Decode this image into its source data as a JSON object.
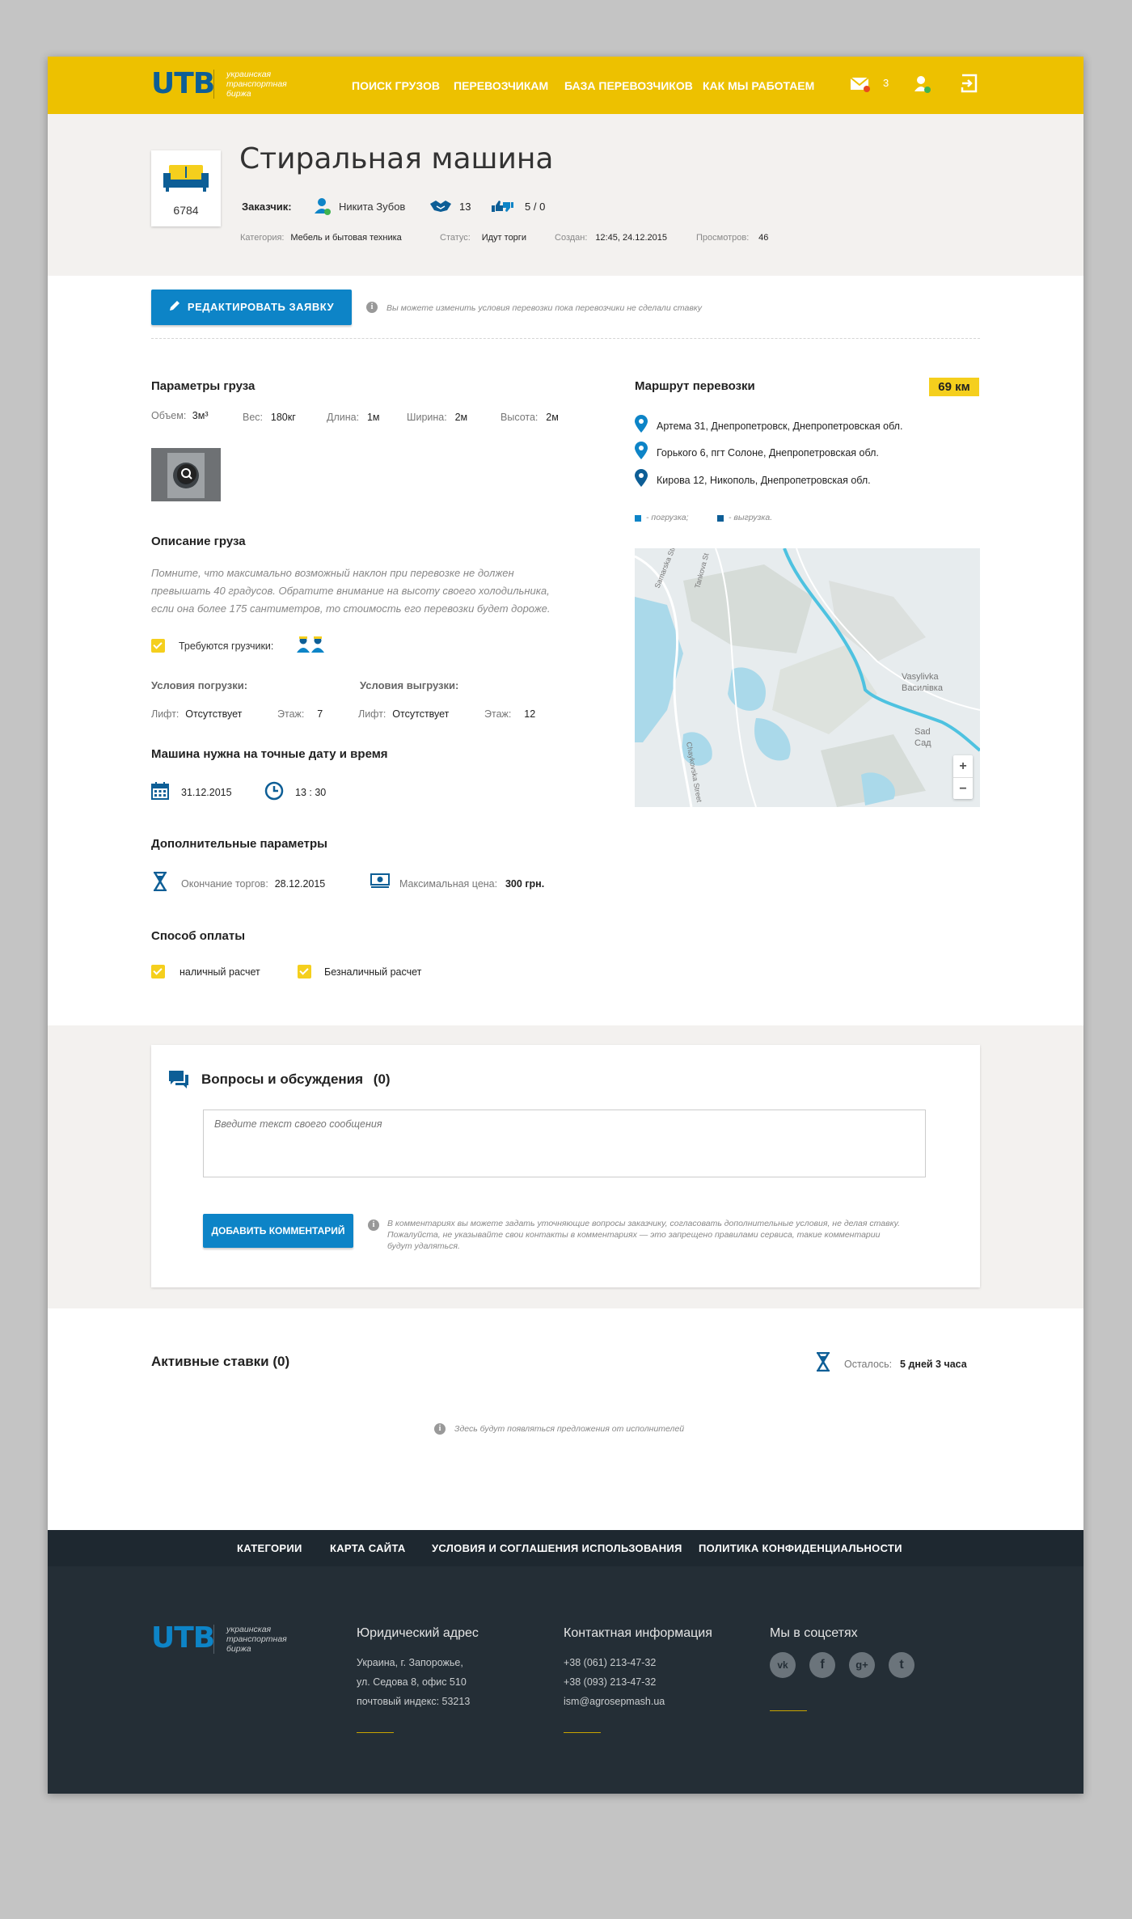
{
  "header": {
    "logo": "UTB",
    "logo_sub": [
      "украинская",
      "транспортная",
      "биржа"
    ],
    "nav": [
      "ПОИСК ГРУЗОВ",
      "ПЕРЕВОЗЧИКАМ",
      "БАЗА ПЕРЕВОЗЧИКОВ",
      "КАК МЫ РАБОТАЕМ"
    ],
    "messages_count": "3"
  },
  "cargo": {
    "id": "6784",
    "title": "Стиральная машина",
    "customer_label": "Заказчик:",
    "customer_name": "Никита Зубов",
    "deals": "13",
    "rating": "5 / 0",
    "meta": [
      {
        "label": "Категория:",
        "value": "Мебель и бытовая техника"
      },
      {
        "label": "Статус:",
        "value": "Идут торги"
      },
      {
        "label": "Создан:",
        "value": "12:45, 24.12.2015"
      },
      {
        "label": "Просмотров:",
        "value": "46"
      }
    ]
  },
  "edit": {
    "button": "РЕДАКТИРОВАТЬ ЗАЯВКУ",
    "note": "Вы можете изменить условия перевозки пока  перевозчики не сделали ставку"
  },
  "params": {
    "title": "Параметры груза",
    "items": [
      {
        "label": "Объем:",
        "value": "3м³"
      },
      {
        "label": "Вес:",
        "value": "180кг"
      },
      {
        "label": "Длина:",
        "value": "1м"
      },
      {
        "label": "Ширина:",
        "value": "2м"
      },
      {
        "label": "Высота:",
        "value": "2м"
      }
    ]
  },
  "description": {
    "title": "Описание груза",
    "lines": [
      "Помните, что максимально возможный наклон при перевозке не должен",
      "превышать 40 градусов. Обратите внимание на высоту своего холодильника,",
      "если она более 175 сантиметров, то стоимость его перевозки будет дороже."
    ],
    "loaders_label": "Требуются грузчики:"
  },
  "conditions": {
    "loading_title": "Условия погрузки:",
    "unloading_title": "Условия выгрузки:",
    "lift_label": "Лифт:",
    "lift_loading": "Отсутствует",
    "lift_unloading": "Отсутствует",
    "floor_label": "Этаж:",
    "floor_loading": "7",
    "floor_unloading": "12"
  },
  "datetime": {
    "title": "Машина нужна на точные дату и время",
    "date": "31.12.2015",
    "time": "13 : 30"
  },
  "extra": {
    "title": "Дополнительные параметры",
    "end_label": "Окончание торгов:",
    "end_value": "28.12.2015",
    "price_label": "Максимальная цена:",
    "price_value": "300 грн."
  },
  "payment": {
    "title": "Способ оплаты",
    "options": [
      "наличный расчет",
      "Безналичный расчет"
    ]
  },
  "route": {
    "title": "Маршрут перевозки",
    "distance": "69 км",
    "points": [
      "Артема 31, Днепропетровск, Днепропетровская обл.",
      "Горького 6, пгт Солоне, Днепропетровская обл.",
      "Кирова 12, Никополь, Днепропетровская обл."
    ],
    "legend_loading": "- погрузка;",
    "legend_unloading": "- выгрузка.",
    "map_labels": {
      "town1": "Vasylivka",
      "town1_cyr": "Василівка",
      "town2": "Sad",
      "town2_cyr": "Сад",
      "street1": "Samarska Street",
      "street2": "Tankova St",
      "street3": "Chaykovska Street"
    },
    "zoom_in": "+",
    "zoom_out": "−"
  },
  "discussion": {
    "title": "Вопросы и обсуждения",
    "count": "(0)",
    "placeholder": "Введите текст своего сообщения",
    "button": "ДОБАВИТЬ КОММЕНТАРИЙ",
    "note_lines": [
      "В комментариях вы можете задать уточняющие вопросы заказчику, согласовать дополнительные условия, не делая ставку.",
      "Пожалуйста, не указывайте свои контакты в комментариях — это запрещено правилами сервиса, такие комментарии",
      "будут удаляться."
    ]
  },
  "bids": {
    "title": "Активные ставки (0)",
    "remaining_label": "Осталось:",
    "remaining_value": "5 дней 3 часа",
    "empty_note": "Здесь будут появляться предложения от исполнителей"
  },
  "footer": {
    "links": [
      "КАТЕГОРИИ",
      "КАРТА САЙТА",
      "УСЛОВИЯ И СОГЛАШЕНИЯ ИСПОЛЬЗОВАНИЯ",
      "ПОЛИТИКА КОНФИДЕНЦИАЛЬНОСТИ"
    ],
    "legal_title": "Юридический  адрес",
    "legal_lines": [
      "Украина, г. Запорожье,",
      "ул. Седова 8, офис 510",
      "почтовый индекс: 53213"
    ],
    "contact_title": "Контактная информация",
    "contact_lines": [
      "+38 (061) 213-47-32",
      "+38 (093) 213-47-32",
      "ism@agrosepmash.ua"
    ],
    "social_title": "Мы в соцсетях",
    "social": [
      "vk",
      "f",
      "g+",
      "t"
    ]
  },
  "colors": {
    "header_yellow": "#edc100",
    "primary_blue": "#0d84c7",
    "dark_blue": "#0d5e96",
    "accent_yellow": "#f5cf1d",
    "route_line": "#4ec2e0"
  }
}
